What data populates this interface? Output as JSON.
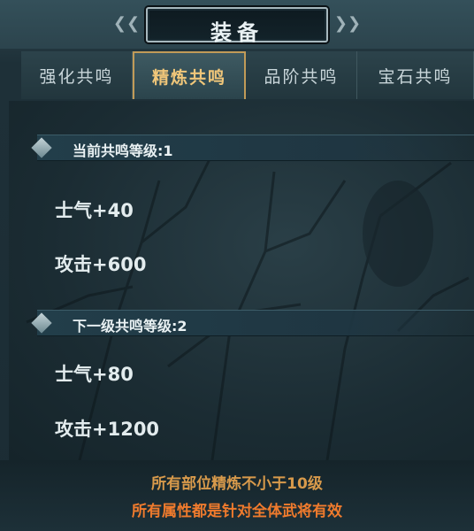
{
  "header": {
    "title": "装备"
  },
  "tabs": [
    {
      "label": "强化共鸣",
      "active": false
    },
    {
      "label": "精炼共鸣",
      "active": true
    },
    {
      "label": "品阶共鸣",
      "active": false
    },
    {
      "label": "宝石共鸣",
      "active": false
    }
  ],
  "current": {
    "heading": "当前共鸣等级:1",
    "stats": [
      "士气+40",
      "攻击+600"
    ]
  },
  "next": {
    "heading": "下一级共鸣等级:2",
    "stats": [
      "士气+80",
      "攻击+1200"
    ]
  },
  "footer": {
    "requirement": "所有部位精炼不小于10级",
    "note": "所有属性都是针对全体武将有效"
  },
  "colors": {
    "active_tab": "#f1c77a",
    "requirement": "#d89a4b",
    "note": "#f07b2d"
  }
}
